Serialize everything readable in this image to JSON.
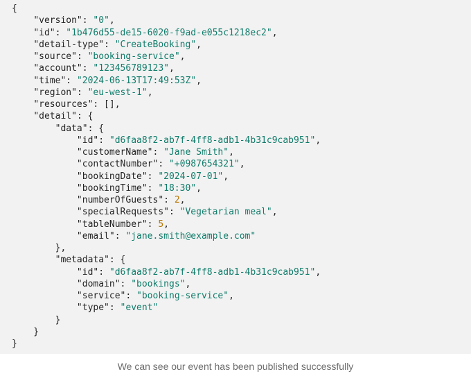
{
  "code_lines": [
    [
      {
        "t": "p",
        "v": "{"
      }
    ],
    [
      {
        "t": "p",
        "v": "    "
      },
      {
        "t": "k",
        "v": "\"version\""
      },
      {
        "t": "p",
        "v": ": "
      },
      {
        "t": "s",
        "v": "\"0\""
      },
      {
        "t": "p",
        "v": ","
      }
    ],
    [
      {
        "t": "p",
        "v": "    "
      },
      {
        "t": "k",
        "v": "\"id\""
      },
      {
        "t": "p",
        "v": ": "
      },
      {
        "t": "s",
        "v": "\"1b476d55-de15-6020-f9ad-e055c1218ec2\""
      },
      {
        "t": "p",
        "v": ","
      }
    ],
    [
      {
        "t": "p",
        "v": "    "
      },
      {
        "t": "k",
        "v": "\"detail-type\""
      },
      {
        "t": "p",
        "v": ": "
      },
      {
        "t": "s",
        "v": "\"CreateBooking\""
      },
      {
        "t": "p",
        "v": ","
      }
    ],
    [
      {
        "t": "p",
        "v": "    "
      },
      {
        "t": "k",
        "v": "\"source\""
      },
      {
        "t": "p",
        "v": ": "
      },
      {
        "t": "s",
        "v": "\"booking-service\""
      },
      {
        "t": "p",
        "v": ","
      }
    ],
    [
      {
        "t": "p",
        "v": "    "
      },
      {
        "t": "k",
        "v": "\"account\""
      },
      {
        "t": "p",
        "v": ": "
      },
      {
        "t": "s",
        "v": "\"123456789123\""
      },
      {
        "t": "p",
        "v": ","
      }
    ],
    [
      {
        "t": "p",
        "v": "    "
      },
      {
        "t": "k",
        "v": "\"time\""
      },
      {
        "t": "p",
        "v": ": "
      },
      {
        "t": "s",
        "v": "\"2024-06-13T17:49:53Z\""
      },
      {
        "t": "p",
        "v": ","
      }
    ],
    [
      {
        "t": "p",
        "v": "    "
      },
      {
        "t": "k",
        "v": "\"region\""
      },
      {
        "t": "p",
        "v": ": "
      },
      {
        "t": "s",
        "v": "\"eu-west-1\""
      },
      {
        "t": "p",
        "v": ","
      }
    ],
    [
      {
        "t": "p",
        "v": "    "
      },
      {
        "t": "k",
        "v": "\"resources\""
      },
      {
        "t": "p",
        "v": ": [],"
      }
    ],
    [
      {
        "t": "p",
        "v": "    "
      },
      {
        "t": "k",
        "v": "\"detail\""
      },
      {
        "t": "p",
        "v": ": {"
      }
    ],
    [
      {
        "t": "p",
        "v": "        "
      },
      {
        "t": "k",
        "v": "\"data\""
      },
      {
        "t": "p",
        "v": ": {"
      }
    ],
    [
      {
        "t": "p",
        "v": "            "
      },
      {
        "t": "k",
        "v": "\"id\""
      },
      {
        "t": "p",
        "v": ": "
      },
      {
        "t": "s",
        "v": "\"d6faa8f2-ab7f-4ff8-adb1-4b31c9cab951\""
      },
      {
        "t": "p",
        "v": ","
      }
    ],
    [
      {
        "t": "p",
        "v": "            "
      },
      {
        "t": "k",
        "v": "\"customerName\""
      },
      {
        "t": "p",
        "v": ": "
      },
      {
        "t": "s",
        "v": "\"Jane Smith\""
      },
      {
        "t": "p",
        "v": ","
      }
    ],
    [
      {
        "t": "p",
        "v": "            "
      },
      {
        "t": "k",
        "v": "\"contactNumber\""
      },
      {
        "t": "p",
        "v": ": "
      },
      {
        "t": "s",
        "v": "\"+0987654321\""
      },
      {
        "t": "p",
        "v": ","
      }
    ],
    [
      {
        "t": "p",
        "v": "            "
      },
      {
        "t": "k",
        "v": "\"bookingDate\""
      },
      {
        "t": "p",
        "v": ": "
      },
      {
        "t": "s",
        "v": "\"2024-07-01\""
      },
      {
        "t": "p",
        "v": ","
      }
    ],
    [
      {
        "t": "p",
        "v": "            "
      },
      {
        "t": "k",
        "v": "\"bookingTime\""
      },
      {
        "t": "p",
        "v": ": "
      },
      {
        "t": "s",
        "v": "\"18:30\""
      },
      {
        "t": "p",
        "v": ","
      }
    ],
    [
      {
        "t": "p",
        "v": "            "
      },
      {
        "t": "k",
        "v": "\"numberOfGuests\""
      },
      {
        "t": "p",
        "v": ": "
      },
      {
        "t": "n",
        "v": "2"
      },
      {
        "t": "p",
        "v": ","
      }
    ],
    [
      {
        "t": "p",
        "v": "            "
      },
      {
        "t": "k",
        "v": "\"specialRequests\""
      },
      {
        "t": "p",
        "v": ": "
      },
      {
        "t": "s",
        "v": "\"Vegetarian meal\""
      },
      {
        "t": "p",
        "v": ","
      }
    ],
    [
      {
        "t": "p",
        "v": "            "
      },
      {
        "t": "k",
        "v": "\"tableNumber\""
      },
      {
        "t": "p",
        "v": ": "
      },
      {
        "t": "n",
        "v": "5"
      },
      {
        "t": "p",
        "v": ","
      }
    ],
    [
      {
        "t": "p",
        "v": "            "
      },
      {
        "t": "k",
        "v": "\"email\""
      },
      {
        "t": "p",
        "v": ": "
      },
      {
        "t": "s",
        "v": "\"jane.smith@example.com\""
      }
    ],
    [
      {
        "t": "p",
        "v": "        },"
      }
    ],
    [
      {
        "t": "p",
        "v": "        "
      },
      {
        "t": "k",
        "v": "\"metadata\""
      },
      {
        "t": "p",
        "v": ": {"
      }
    ],
    [
      {
        "t": "p",
        "v": "            "
      },
      {
        "t": "k",
        "v": "\"id\""
      },
      {
        "t": "p",
        "v": ": "
      },
      {
        "t": "s",
        "v": "\"d6faa8f2-ab7f-4ff8-adb1-4b31c9cab951\""
      },
      {
        "t": "p",
        "v": ","
      }
    ],
    [
      {
        "t": "p",
        "v": "            "
      },
      {
        "t": "k",
        "v": "\"domain\""
      },
      {
        "t": "p",
        "v": ": "
      },
      {
        "t": "s",
        "v": "\"bookings\""
      },
      {
        "t": "p",
        "v": ","
      }
    ],
    [
      {
        "t": "p",
        "v": "            "
      },
      {
        "t": "k",
        "v": "\"service\""
      },
      {
        "t": "p",
        "v": ": "
      },
      {
        "t": "s",
        "v": "\"booking-service\""
      },
      {
        "t": "p",
        "v": ","
      }
    ],
    [
      {
        "t": "p",
        "v": "            "
      },
      {
        "t": "k",
        "v": "\"type\""
      },
      {
        "t": "p",
        "v": ": "
      },
      {
        "t": "s",
        "v": "\"event\""
      }
    ],
    [
      {
        "t": "p",
        "v": "        }"
      }
    ],
    [
      {
        "t": "p",
        "v": "    }"
      }
    ],
    [
      {
        "t": "p",
        "v": "}"
      }
    ]
  ],
  "caption": "We can see our event has been published successfully",
  "colors": {
    "panel_background": "#f2f2f2",
    "key_text": "#242424",
    "string_value": "#0f7c6a",
    "number_value": "#b77600",
    "caption_text": "#6b6b6b"
  }
}
